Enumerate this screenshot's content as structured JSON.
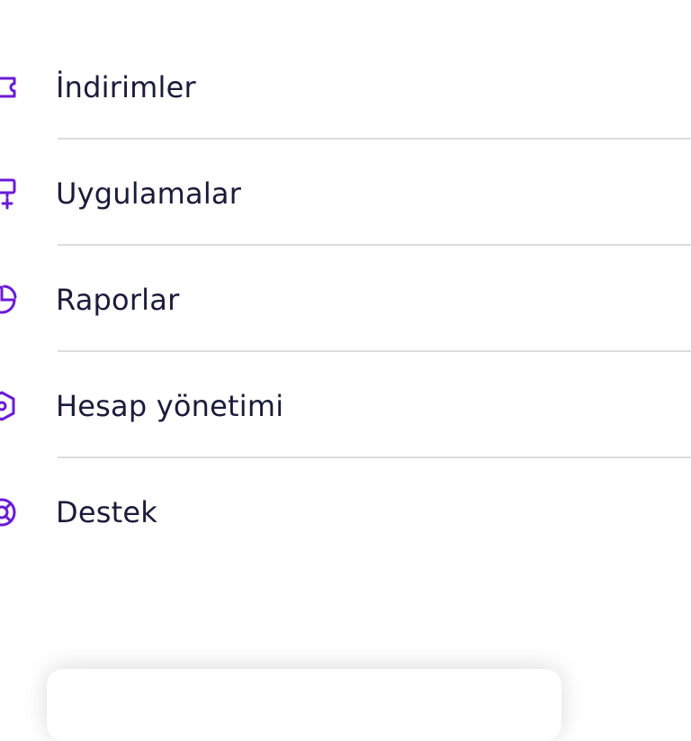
{
  "menu": {
    "items": [
      {
        "label": "İndirimler",
        "icon": "ticket-icon"
      },
      {
        "label": "Uygulamalar",
        "icon": "apps-add-icon"
      },
      {
        "label": "Raporlar",
        "icon": "report-icon"
      },
      {
        "label": "Hesap yönetimi",
        "icon": "account-icon"
      },
      {
        "label": "Destek",
        "icon": "lifebuoy-icon"
      }
    ]
  },
  "colors": {
    "accent": "#6a1bd6",
    "text": "#1b1b3a",
    "divider": "#dcdcdc"
  }
}
